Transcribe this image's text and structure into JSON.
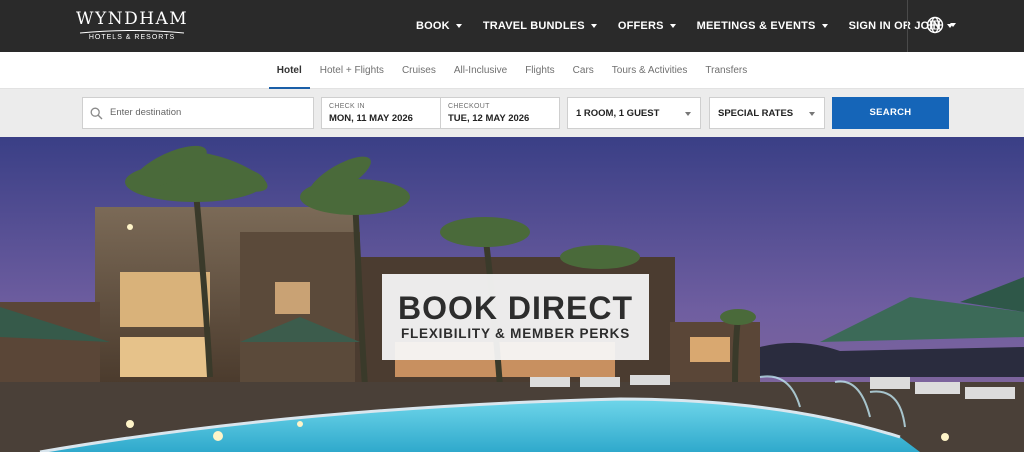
{
  "brand": {
    "name": "WYNDHAM",
    "tagline": "HOTELS & RESORTS"
  },
  "nav": {
    "items": [
      {
        "label": "BOOK"
      },
      {
        "label": "TRAVEL BUNDLES"
      },
      {
        "label": "OFFERS"
      },
      {
        "label": "MEETINGS & EVENTS"
      },
      {
        "label": "SIGN IN OR JOIN"
      }
    ],
    "language_icon": "globe-icon"
  },
  "tabs": [
    {
      "label": "Hotel",
      "active": true
    },
    {
      "label": "Hotel + Flights",
      "active": false
    },
    {
      "label": "Cruises",
      "active": false
    },
    {
      "label": "All-Inclusive",
      "active": false
    },
    {
      "label": "Flights",
      "active": false
    },
    {
      "label": "Cars",
      "active": false
    },
    {
      "label": "Tours & Activities",
      "active": false
    },
    {
      "label": "Transfers",
      "active": false
    }
  ],
  "search": {
    "destination_placeholder": "Enter destination",
    "checkin_label": "CHECK IN",
    "checkin_value": "MON, 11 MAY 2026",
    "checkout_label": "CHECKOUT",
    "checkout_value": "TUE, 12 MAY 2026",
    "rooms_value": "1 ROOM, 1 GUEST",
    "rates_value": "SPECIAL RATES",
    "button_label": "SEARCH"
  },
  "hero": {
    "headline": "BOOK DIRECT",
    "subheadline": "FLEXIBILITY & MEMBER PERKS"
  },
  "colors": {
    "topbar": "#2a2a2a",
    "accent": "#1565b8",
    "tab_underline": "#1a5fa8"
  }
}
